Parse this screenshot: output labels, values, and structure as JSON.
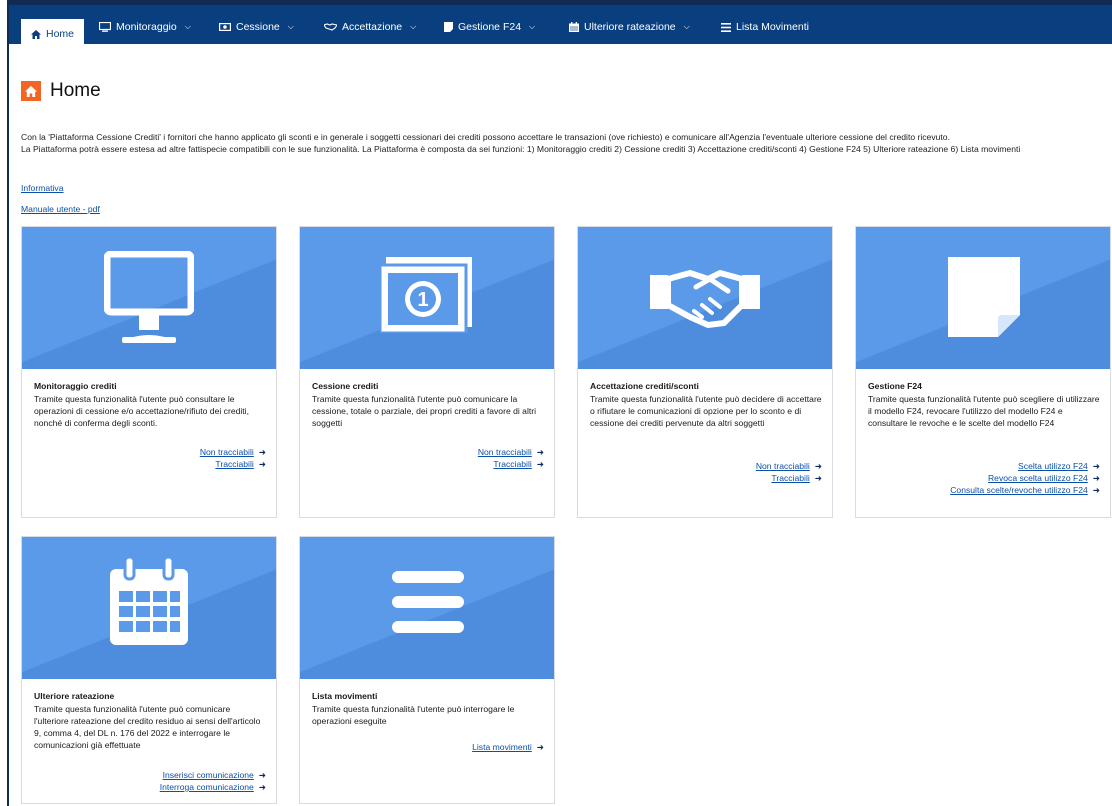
{
  "nav": {
    "home": "Home",
    "monitoraggio": "Monitoraggio",
    "cessione": "Cessione",
    "accettazione": "Accettazione",
    "gestione_f24": "Gestione F24",
    "ulteriore_rateazione": "Ulteriore rateazione",
    "lista_movimenti": "Lista Movimenti"
  },
  "page": {
    "title": "Home",
    "intro_1": "Con la 'Piattaforma Cessione Crediti' i fornitori che hanno applicato gli sconti e in generale i soggetti cessionari dei crediti possono accettare le transazioni (ove richiesto) e comunicare all'Agenzia l'eventuale ulteriore cessione del credito ricevuto.",
    "intro_2": "La Piattaforma potrà essere estesa ad altre fattispecie compatibili con le sue funzionalità. La Piattaforma è composta da sei funzioni: 1) Monitoraggio crediti 2) Cessione crediti 3) Accettazione crediti/sconti 4) Gestione F24 5) Ulteriore rateazione 6) Lista movimenti",
    "link_informativa": "Informativa",
    "link_manuale": "Manuale utente - pdf"
  },
  "cards": {
    "monitoraggio": {
      "title": "Monitoraggio crediti",
      "desc": "Tramite questa funzionalità l'utente può consultare le operazioni di cessione e/o accettazione/rifiuto dei crediti, nonché di conferma degli sconti.",
      "links": [
        "Non tracciabili",
        "Tracciabili"
      ]
    },
    "cessione": {
      "title": "Cessione crediti",
      "desc": "Tramite questa funzionalità l'utente può comunicare la cessione, totale o parziale, dei propri crediti a favore di altri soggetti",
      "links": [
        "Non tracciabili",
        "Tracciabili"
      ]
    },
    "accettazione": {
      "title": "Accettazione crediti/sconti",
      "desc": "Tramite questa funzionalità l'utente può decidere di accettare o rifiutare le comunicazioni di opzione per lo sconto e di cessione dei crediti pervenute da altri soggetti",
      "links": [
        "Non tracciabili",
        "Tracciabili"
      ]
    },
    "gestione_f24": {
      "title": "Gestione F24",
      "desc": "Tramite questa funzionalità l'utente può scegliere di utilizzare il modello F24, revocare l'utilizzo del modello F24 e consultare le revoche e le scelte del modello F24",
      "links": [
        "Scelta utilizzo F24",
        "Revoca scelta utilizzo F24",
        "Consulta scelte/revoche utilizzo F24"
      ]
    },
    "rateazione": {
      "title": "Ulteriore rateazione",
      "desc": "Tramite questa funzionalità l'utente può comunicare l'ulteriore rateazione del credito residuo ai sensi dell'articolo 9, comma 4, del DL n. 176 del 2022 e interrogare le comunicazioni già effettuate",
      "links": [
        "Inserisci comunicazione",
        "Interroga comunicazione"
      ]
    },
    "lista": {
      "title": "Lista movimenti",
      "desc": "Tramite questa funzionalità l'utente può interrogare le operazioni eseguite",
      "links": [
        "Lista movimenti"
      ]
    }
  },
  "icons": {
    "home": "home-icon",
    "monitoraggio": "monitor-icon",
    "cessione": "banknote-icon",
    "accettazione": "handshake-icon",
    "gestione_f24": "document-icon",
    "rateazione": "calendar-icon",
    "lista": "list-icon",
    "link_arrow": "arrow-right-icon"
  },
  "colors": {
    "navbar": "#0a3f7f",
    "card_image": "#5b9ae8",
    "home_badge": "#f26522",
    "link": "#0b4fa8"
  }
}
